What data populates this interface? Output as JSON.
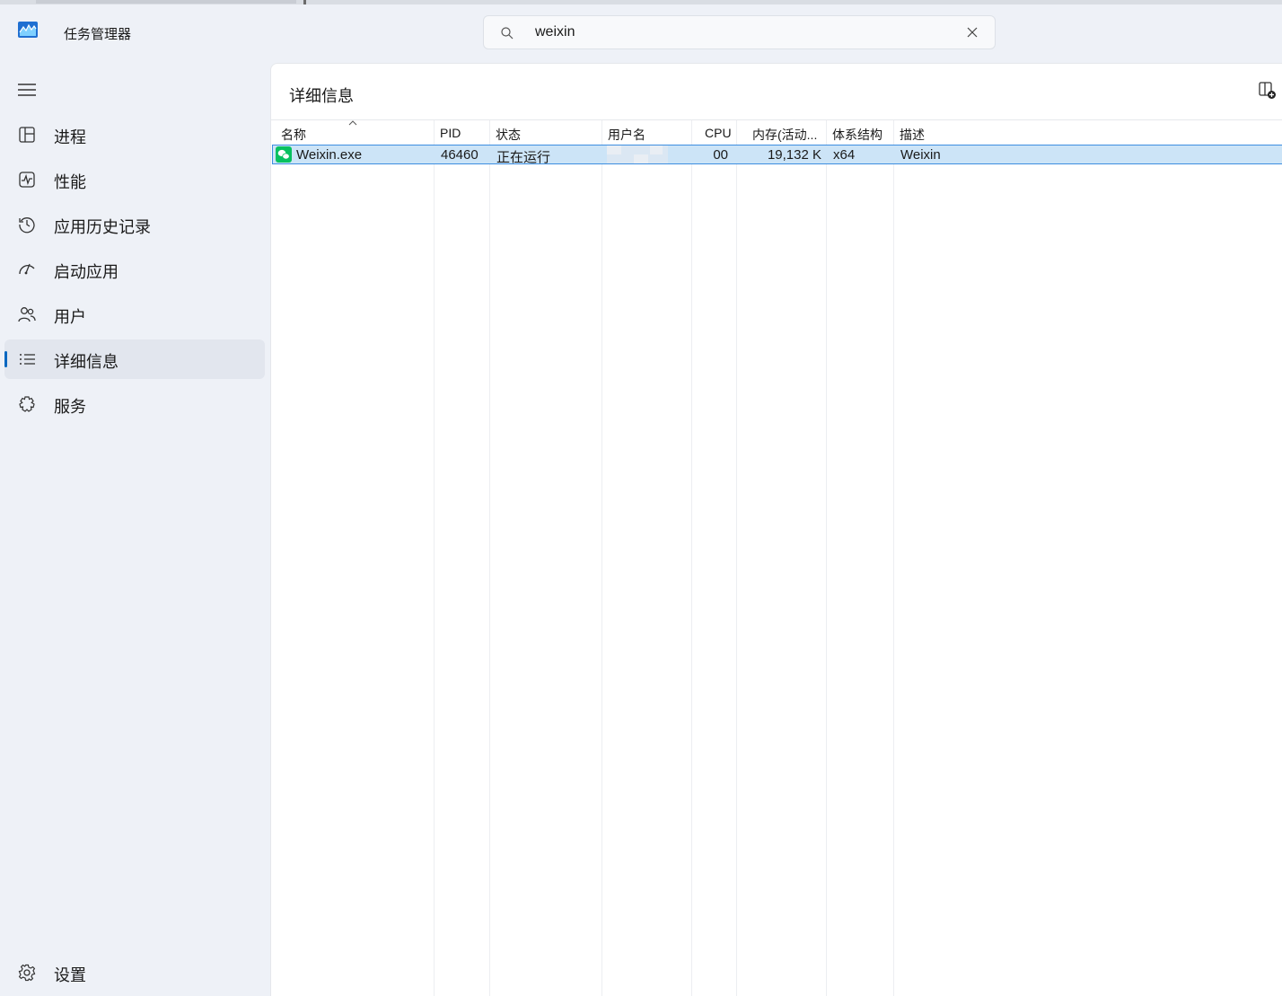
{
  "app": {
    "title": "任务管理器"
  },
  "search": {
    "value": "weixin"
  },
  "sidebar": {
    "items": [
      {
        "label": "进程",
        "icon": "processes-icon"
      },
      {
        "label": "性能",
        "icon": "performance-icon"
      },
      {
        "label": "应用历史记录",
        "icon": "history-icon"
      },
      {
        "label": "启动应用",
        "icon": "startup-icon"
      },
      {
        "label": "用户",
        "icon": "users-icon"
      },
      {
        "label": "详细信息",
        "icon": "details-icon",
        "active": true
      },
      {
        "label": "服务",
        "icon": "services-icon"
      }
    ],
    "settings_label": "设置"
  },
  "details": {
    "title": "详细信息",
    "columns": [
      "名称",
      "PID",
      "状态",
      "用户名",
      "CPU",
      "内存(活动...",
      "体系结构",
      "描述"
    ],
    "rows": [
      {
        "name": "Weixin.exe",
        "pid": "46460",
        "status": "正在运行",
        "user": "",
        "cpu": "00",
        "memory": "19,132 K",
        "arch": "x64",
        "desc": "Weixin"
      }
    ]
  },
  "colors": {
    "accent": "#0067c0",
    "selection": "#cce4f7",
    "wechat": "#07c160"
  }
}
